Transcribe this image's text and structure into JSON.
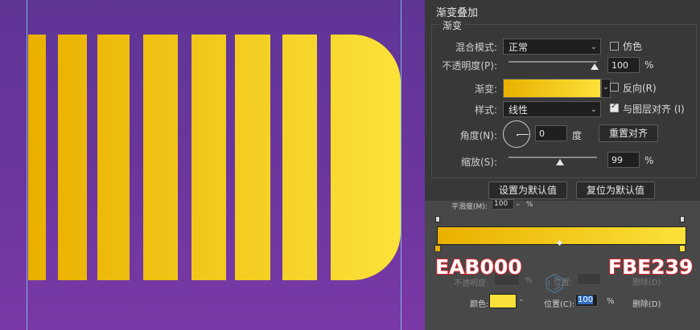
{
  "canvas": {
    "background": "#6c369d",
    "bar_color_left": "#EAB000",
    "bar_color_right": "#FBE239"
  },
  "panel": {
    "section_title": "渐变叠加",
    "group_title": "渐变",
    "blend_mode": {
      "label": "混合模式:",
      "value": "正常"
    },
    "dither": {
      "label": "仿色",
      "checked": false
    },
    "opacity": {
      "label": "不透明度(P):",
      "value": "100",
      "unit": "%",
      "level": 1.0
    },
    "gradient": {
      "label": "渐变:"
    },
    "reverse": {
      "label": "反向(R)",
      "checked": false
    },
    "style": {
      "label": "样式:",
      "value": "线性"
    },
    "align": {
      "label": "与图层对齐 (I)",
      "checked": true
    },
    "angle": {
      "label": "角度(N):",
      "value": "0",
      "unit": "度"
    },
    "reset_align_button": "重置对齐",
    "scale": {
      "label": "缩放(S):",
      "value": "99",
      "unit": "%",
      "level": 0.99
    },
    "set_default_button": "设置为默认值",
    "reset_default_button": "复位为默认值"
  },
  "editor": {
    "smoothness": {
      "label": "平滑度(M):",
      "value": "100",
      "unit": "%"
    },
    "stop_opacity_label": "不透明度:",
    "stop_opacity_unit": "%",
    "position_label_top": "位置:",
    "delete_label_top": "删除(D)",
    "color_label": "颜色:",
    "position_label": "位置(C):",
    "position_value": "100",
    "position_unit": "%",
    "delete_label": "删除(D)",
    "color_start": "#EAB000",
    "color_end": "#FBE239",
    "swatch_color": "#F9E239"
  },
  "overlay": {
    "left_code": "EAB000",
    "right_code": "FBE239"
  }
}
